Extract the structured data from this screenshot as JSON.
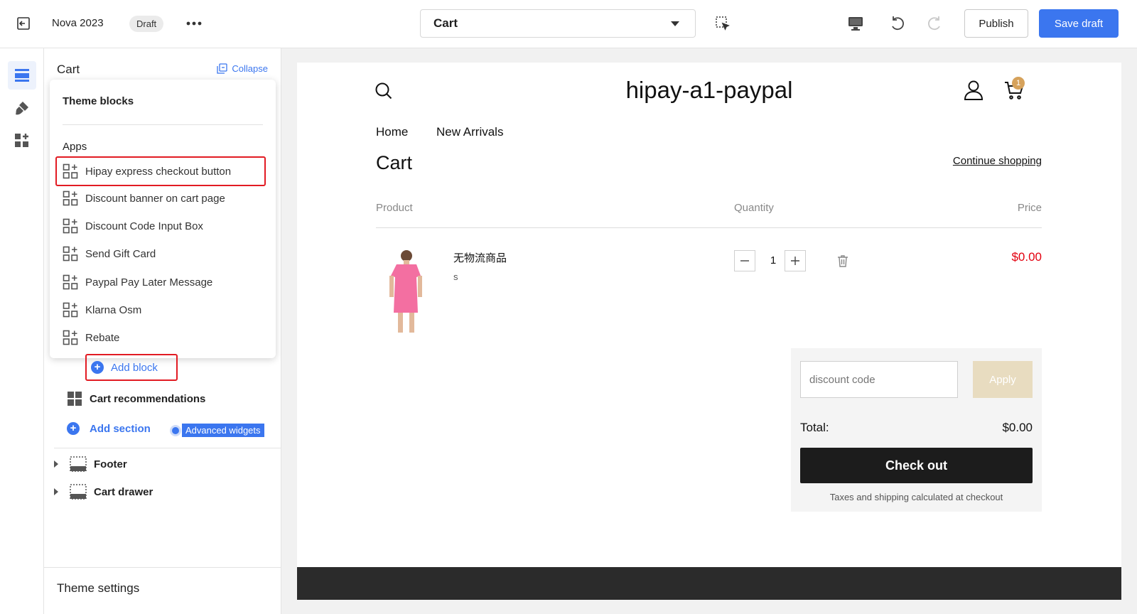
{
  "topbar": {
    "theme_name": "Nova 2023",
    "draft_badge": "Draft",
    "template_select": "Cart",
    "publish_label": "Publish",
    "save_label": "Save draft"
  },
  "panel": {
    "title": "Cart",
    "collapse_label": "Collapse",
    "popover": {
      "heading": "Theme blocks",
      "apps_label": "Apps",
      "apps": [
        "Hipay express checkout button",
        "Discount banner on cart page",
        "Discount Code Input Box",
        "Send Gift Card",
        "Paypal Pay Later Message",
        "Klarna Osm",
        "Rebate"
      ]
    },
    "add_block_label": "Add block",
    "cart_recommendations_label": "Cart recommendations",
    "add_section_label": "Add section",
    "advanced_widgets_label": "Advanced widgets",
    "footer_label": "Footer",
    "cart_drawer_label": "Cart drawer",
    "theme_settings_label": "Theme settings"
  },
  "preview": {
    "store_name": "hipay-a1-paypal",
    "cart_count": "1",
    "nav": [
      "Home",
      "New Arrivals"
    ],
    "cart_heading": "Cart",
    "continue_shopping": "Continue shopping",
    "columns": {
      "product": "Product",
      "quantity": "Quantity",
      "price": "Price"
    },
    "item": {
      "name": "无物流商品",
      "variant": "s",
      "quantity": "1",
      "price": "$0.00"
    },
    "discount_placeholder": "discount code",
    "apply_label": "Apply",
    "total_label": "Total:",
    "total_value": "$0.00",
    "checkout_label": "Check out",
    "tax_note": "Taxes and shipping calculated at checkout"
  },
  "colors": {
    "accent": "#3b76ef",
    "highlight_border": "#e21b23",
    "price": "#e3000f",
    "checkout_bg": "#1c1c1c",
    "apply_bg": "#e8dcc0",
    "cart_badge": "#d6a25b"
  }
}
